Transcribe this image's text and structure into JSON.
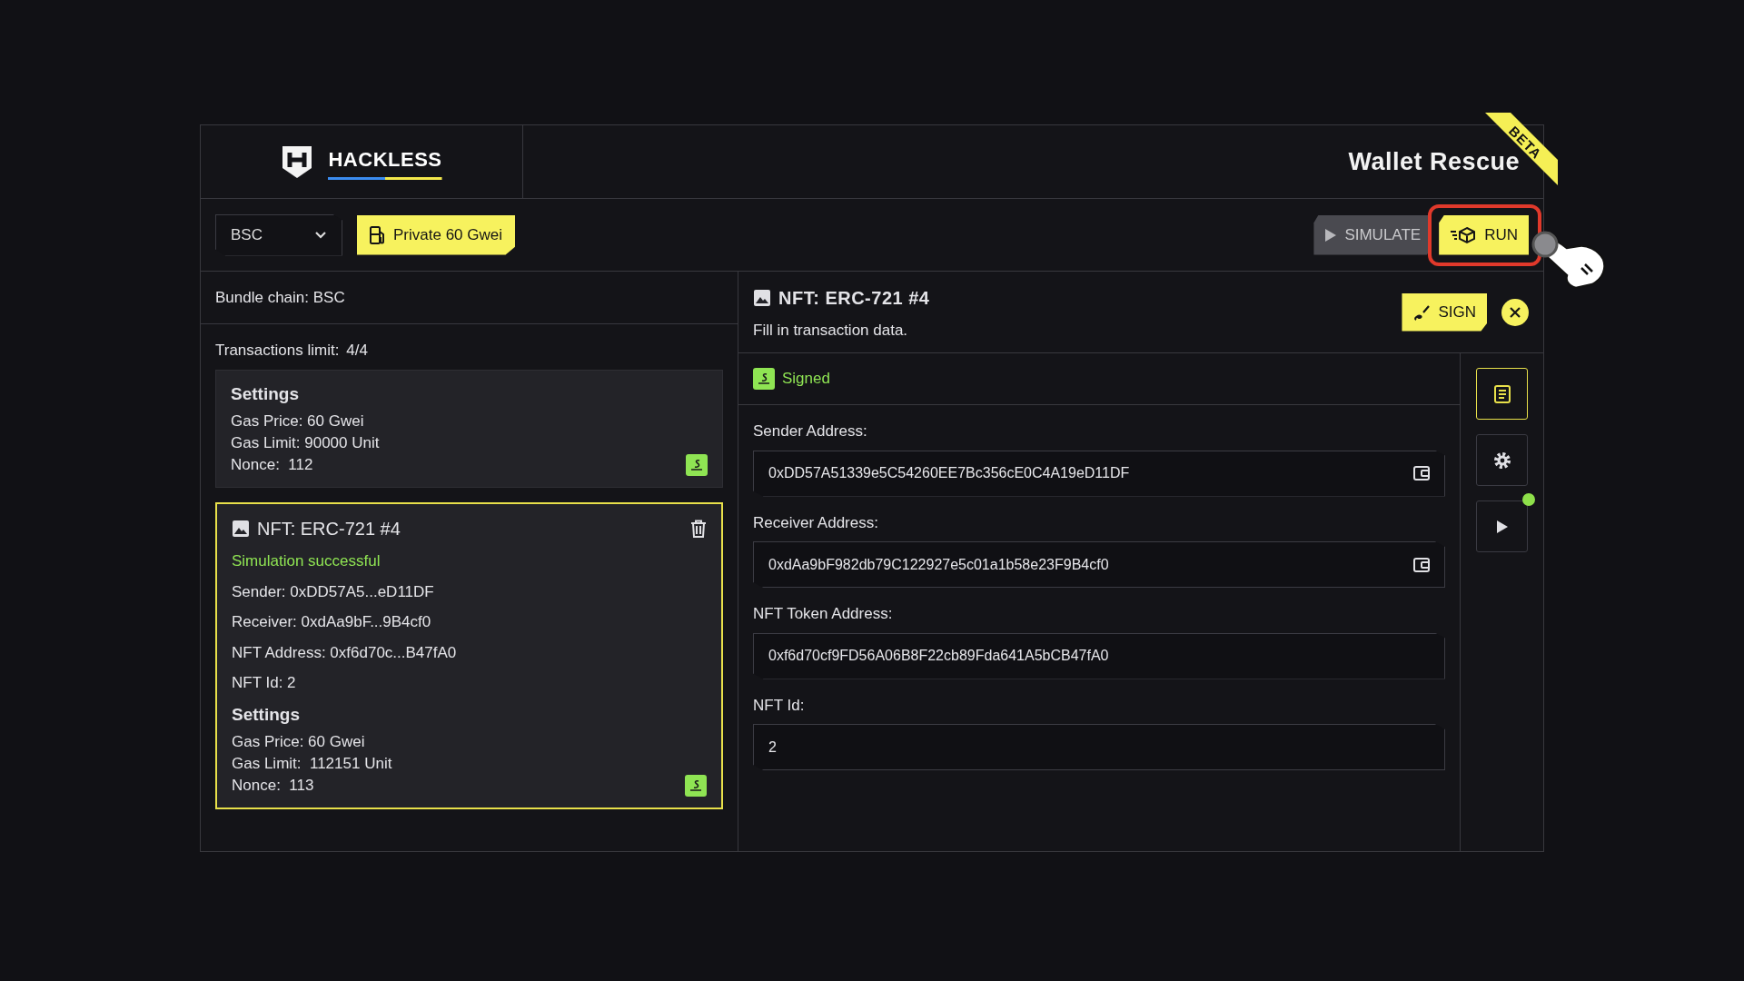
{
  "header": {
    "logo": "HACKLESS",
    "title": "Wallet Rescue",
    "ribbon": "BETA"
  },
  "toolbar": {
    "network": "BSC",
    "gas_badge": "Private 60 Gwei",
    "buttons": [
      {
        "label": "SIMULATE",
        "kind": "simulate",
        "highlighted": false
      },
      {
        "label": "RUN",
        "kind": "run",
        "highlighted": true
      }
    ]
  },
  "left": {
    "bundle_chain": "Bundle chain: BSC",
    "tx_limit_label": "Transactions limit:",
    "tx_limit_value": "4/4",
    "cards": [
      {
        "kind": "settings",
        "selected": false,
        "signed": true,
        "settings_title": "Settings",
        "settings": [
          "Gas Price: 60 Gwei",
          "Gas Limit: 90000 Unit",
          "Nonce:  112"
        ]
      },
      {
        "kind": "nft",
        "selected": true,
        "signed": true,
        "title": "NFT: ERC-721 #4",
        "status": "Simulation successful",
        "details": [
          "Sender: 0xDD57A5...eD11DF",
          "Receiver: 0xdAa9bF...9B4cf0",
          "NFT Address: 0xf6d70c...B47fA0",
          "NFT Id: 2"
        ],
        "settings_title": "Settings",
        "settings": [
          "Gas Price: 60 Gwei",
          "Gas Limit:  112151 Unit",
          "Nonce:  113"
        ]
      }
    ]
  },
  "editor": {
    "title": "NFT: ERC-721 #4",
    "subtitle": "Fill in transaction data.",
    "sign_button": "SIGN",
    "status": "Signed",
    "fields": [
      {
        "label": "Sender Address:",
        "value": "0xDD57A51339e5C54260EE7Bc356cE0C4A19eD11DF",
        "wallet_button": true
      },
      {
        "label": "Receiver Address:",
        "value": "0xdAa9bF982db79C122927e5c01a1b58e23F9B4cf0",
        "wallet_button": true
      },
      {
        "label": "NFT Token Address:",
        "value": "0xf6d70cf9FD56A06B8F22cb89Fda641A5bCB47fA0",
        "wallet_button": false
      },
      {
        "label": "NFT Id:",
        "value": "2",
        "wallet_button": false
      }
    ],
    "rail": [
      {
        "kind": "notes",
        "selected": true
      },
      {
        "kind": "settings",
        "selected": false
      },
      {
        "kind": "play",
        "selected": false,
        "color": "#8ee04a"
      }
    ]
  }
}
